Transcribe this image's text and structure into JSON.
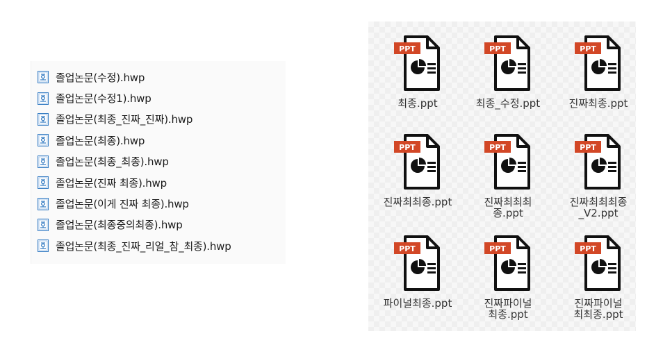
{
  "hwp_files": [
    "졸업논문(수정).hwp",
    "졸업논문(수정1).hwp",
    "졸업논문(최종_진짜_진짜).hwp",
    "졸업논문(최종).hwp",
    "졸업논문(최종_최종).hwp",
    "졸업논문(진짜 최종).hwp",
    "졸업논문(이게 진짜 최종).hwp",
    "졸업논문(최종중의최종).hwp",
    "졸업논문(최종_진짜_리얼_참_최종).hwp"
  ],
  "ppt_badge": "PPT",
  "ppt_files": [
    {
      "lines": [
        "최종.ppt"
      ]
    },
    {
      "lines": [
        "최종_수정.ppt"
      ]
    },
    {
      "lines": [
        "진짜최종.ppt"
      ]
    },
    {
      "lines": [
        "진짜최최종.ppt"
      ]
    },
    {
      "lines": [
        "진짜최최최",
        "종.ppt"
      ]
    },
    {
      "lines": [
        "진짜최최최종",
        "_V2.ppt"
      ]
    },
    {
      "lines": [
        "파이널최종.ppt"
      ]
    },
    {
      "lines": [
        "진짜파이널",
        "최종.ppt"
      ]
    },
    {
      "lines": [
        "진짜파이널",
        "최최종.ppt"
      ]
    }
  ],
  "colors": {
    "ppt_badge": "#d24726",
    "hwp_icon": "#3a7fc4"
  }
}
